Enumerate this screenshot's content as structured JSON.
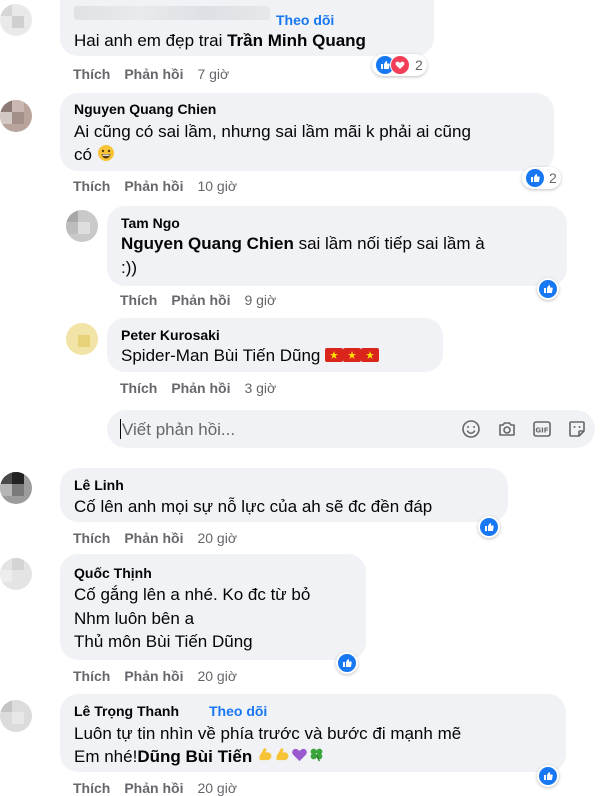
{
  "comments": [
    {
      "name": "",
      "follow_label": "Theo dõi",
      "text_prefix": "Hai anh em đẹp trai ",
      "mention": "Trần Minh Quang",
      "like_label": "Thích",
      "reply_label": "Phản hồi",
      "time": "7 giờ",
      "reaction_count": "2"
    },
    {
      "name": "Nguyen Quang Chien",
      "text_line1": "Ai cũng có sai lầm, nhưng sai lầm mãi k phải ai cũng",
      "text_line2": "có",
      "like_label": "Thích",
      "reply_label": "Phản hồi",
      "time": "10 giờ",
      "reaction_count": "2"
    },
    {
      "name": "Tam Ngo",
      "mention": "Nguyen Quang Chien",
      "text_suffix": " sai lầm nối tiếp sai lầm à",
      "text_line2": ":))",
      "like_label": "Thích",
      "reply_label": "Phản hồi",
      "time": "9 giờ"
    },
    {
      "name": "Peter Kurosaki",
      "text": "Spider-Man Bùi Tiến Dũng",
      "like_label": "Thích",
      "reply_label": "Phản hồi",
      "time": "3 giờ"
    },
    {
      "name": "Lê Linh",
      "text": "Cố lên anh mọi sự nỗ lực của ah sẽ đc đền đáp",
      "like_label": "Thích",
      "reply_label": "Phản hồi",
      "time": "20 giờ"
    },
    {
      "name": "Quốc Thịnh",
      "text_line1": "Cố gắng lên a nhé. Ko đc từ bỏ",
      "text_line2": "Nhm luôn bên a",
      "text_line3": "Thủ môn Bùi Tiến Dũng",
      "like_label": "Thích",
      "reply_label": "Phản hồi",
      "time": "20 giờ"
    },
    {
      "name": "Lê Trọng Thanh",
      "follow_label": "Theo dõi",
      "text_line1": "Luôn tự tin nhìn về phía trước và bước đi mạnh mẽ",
      "text_line2_prefix": "Em nhé!",
      "mention": "Dũng Bùi Tiến",
      "like_label": "Thích",
      "reply_label": "Phản hồi",
      "time": "20 giờ"
    }
  ],
  "reply_box": {
    "placeholder": "Viết phản hồi..."
  },
  "colors": {
    "accent": "#1877f2",
    "bubble": "#f0f2f5",
    "secondary_text": "#65676b",
    "love": "#f33e58"
  },
  "icons": [
    "like-icon",
    "love-icon",
    "smiley-icon",
    "camera-icon",
    "gif-icon",
    "sticker-icon",
    "flag-vn-icon",
    "grin-emoji",
    "muscle-emoji",
    "heart-emoji",
    "clover-emoji"
  ]
}
